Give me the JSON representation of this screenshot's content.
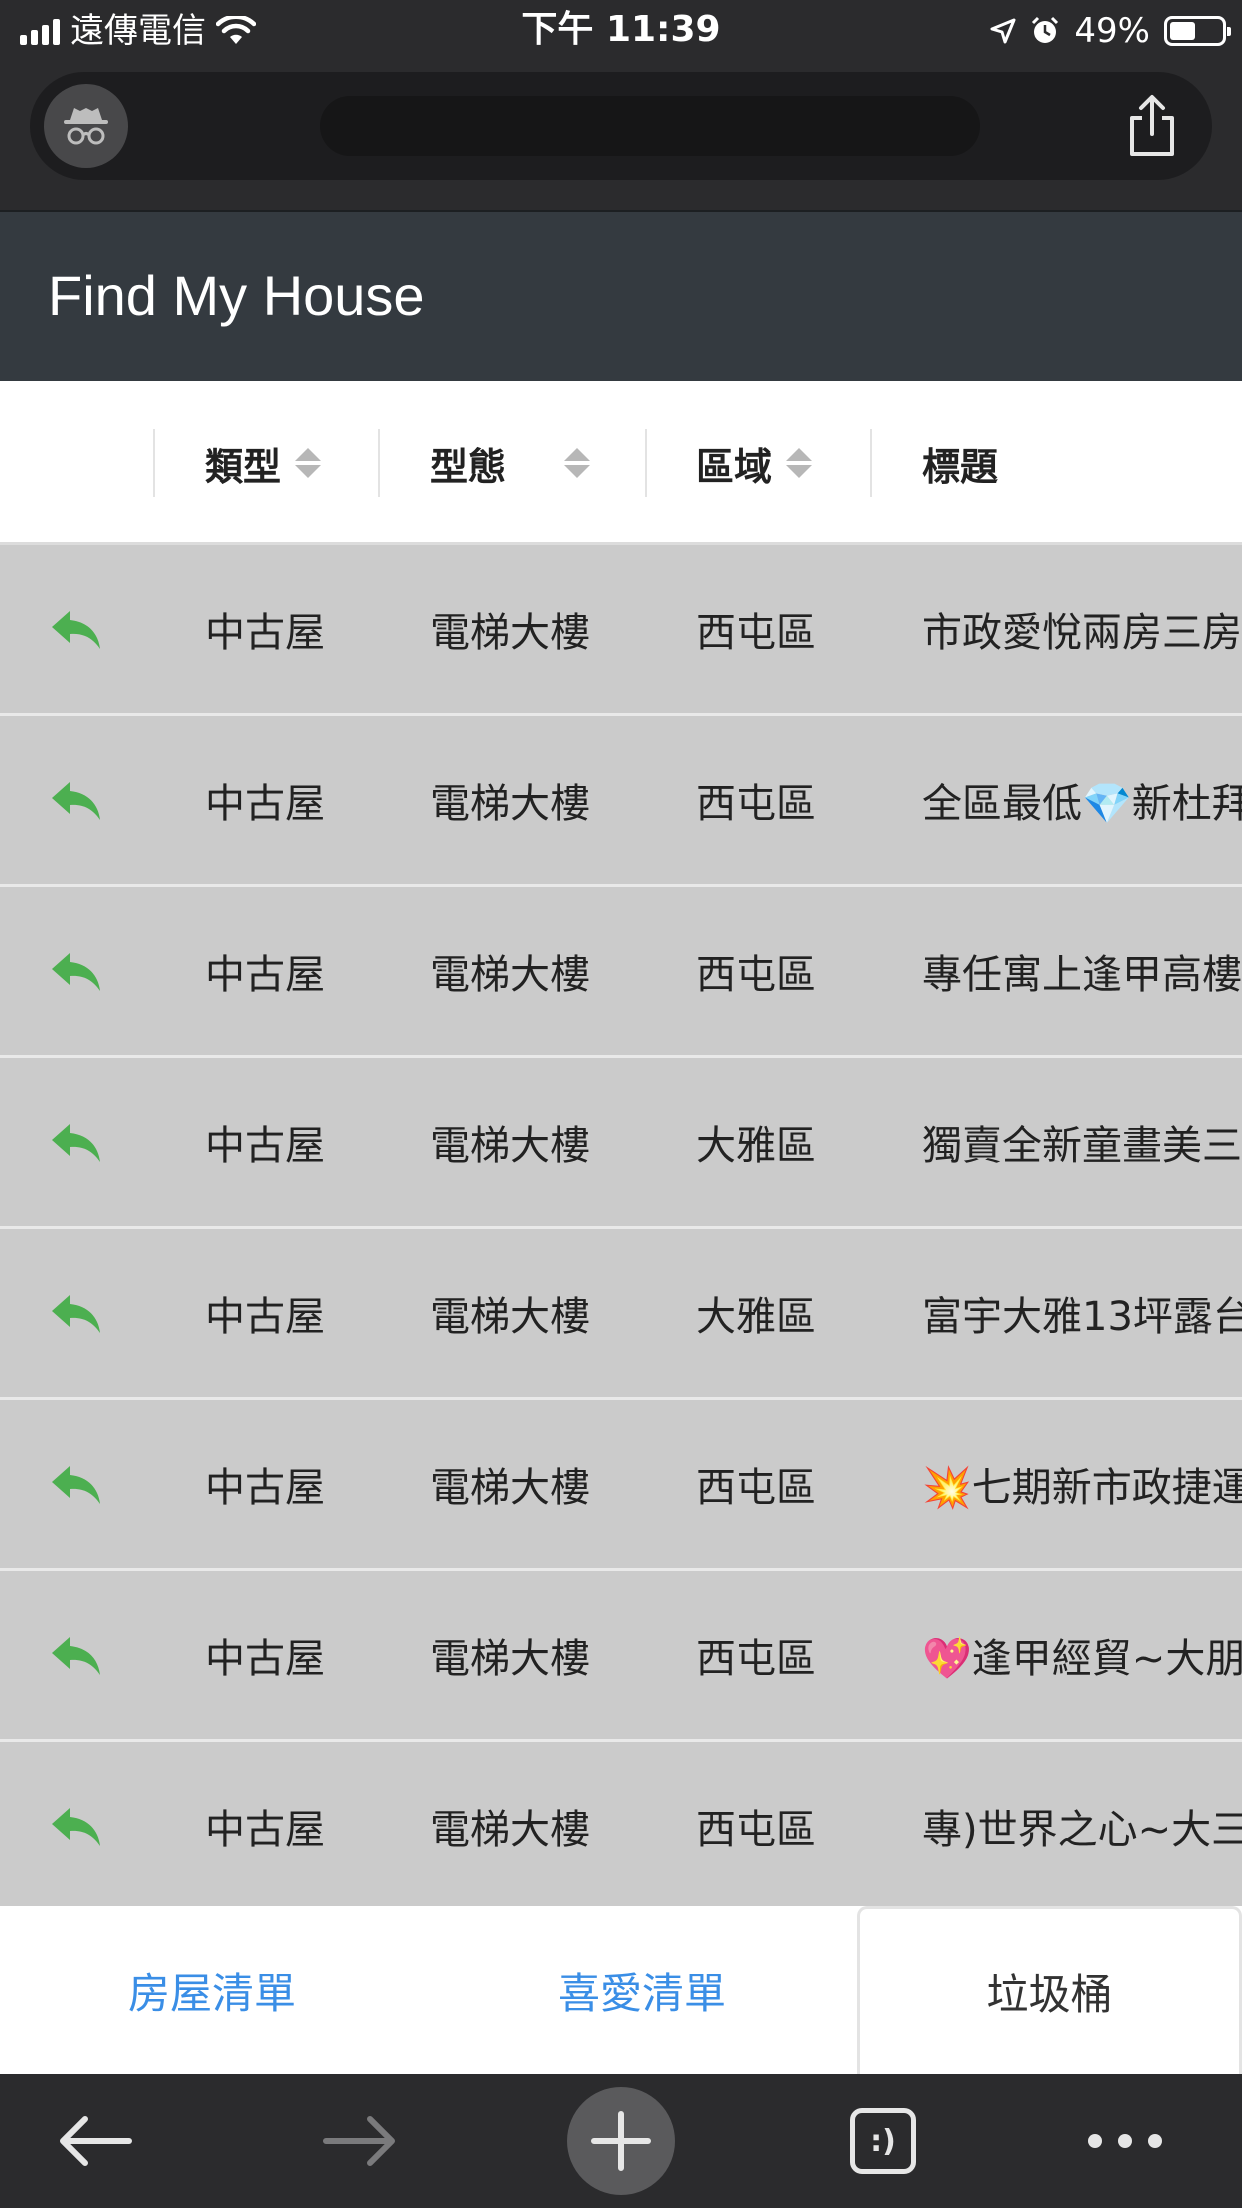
{
  "status_bar": {
    "carrier": "遠傳電信",
    "time": "下午 11:39",
    "battery_percent": "49%",
    "battery_level": 0.49,
    "icons": [
      "signal-icon",
      "wifi-icon",
      "location-arrow-icon",
      "alarm-icon",
      "battery-icon"
    ]
  },
  "browser": {
    "incognito_icon": "incognito-icon",
    "share_icon": "share-icon",
    "toolbar_icons": [
      "back-arrow-icon",
      "forward-arrow-icon",
      "new-tab-plus-icon",
      "tab-switcher-icon",
      "more-dots-icon"
    ],
    "tab_switcher_label": ":)"
  },
  "header": {
    "title": "Find My House"
  },
  "table": {
    "columns": [
      "類型",
      "型態",
      "區域",
      "標題"
    ],
    "rows": [
      {
        "type": "中古屋",
        "form": "電梯大樓",
        "area": "西屯區",
        "title": "市政愛悅兩房三房"
      },
      {
        "type": "中古屋",
        "form": "電梯大樓",
        "area": "西屯區",
        "title": "全區最低💎新杜拜"
      },
      {
        "type": "中古屋",
        "form": "電梯大樓",
        "area": "西屯區",
        "title": "專任寓上逢甲高樓"
      },
      {
        "type": "中古屋",
        "form": "電梯大樓",
        "area": "大雅區",
        "title": "獨賣全新童畫美三"
      },
      {
        "type": "中古屋",
        "form": "電梯大樓",
        "area": "大雅區",
        "title": "富宇大雅13坪露台"
      },
      {
        "type": "中古屋",
        "form": "電梯大樓",
        "area": "西屯區",
        "title": "💥七期新市政捷運"
      },
      {
        "type": "中古屋",
        "form": "電梯大樓",
        "area": "西屯區",
        "title": "💖逢甲經貿~大朋"
      },
      {
        "type": "中古屋",
        "form": "電梯大樓",
        "area": "西屯區",
        "title": "專)世界之心~大三"
      }
    ],
    "restore_icon": "reply-arrow-icon",
    "restore_color": "#4caf50"
  },
  "bottom_tabs": [
    {
      "label": "房屋清單",
      "active": false
    },
    {
      "label": "喜愛清單",
      "active": false
    },
    {
      "label": "垃圾桶",
      "active": true
    }
  ],
  "colors": {
    "header_bg": "#343a40",
    "row_bg": "#cbcbcb",
    "tab_link": "#3a8ee6",
    "restore_icon": "#4caf50"
  }
}
